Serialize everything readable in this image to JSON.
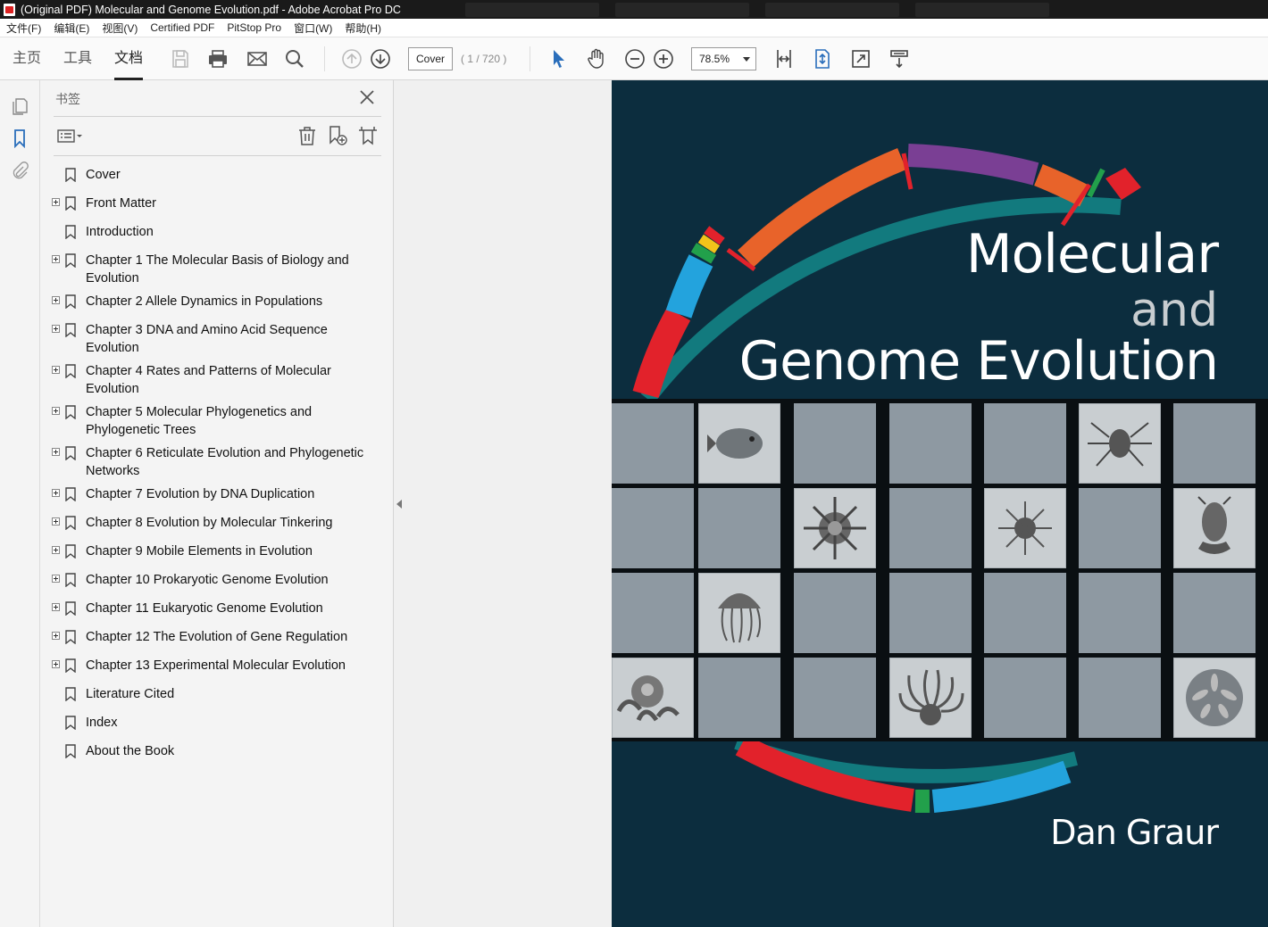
{
  "window": {
    "title": "(Original PDF) Molecular and Genome Evolution.pdf - Adobe Acrobat Pro DC"
  },
  "menubar": {
    "items": [
      "文件(F)",
      "编辑(E)",
      "视图(V)",
      "Certified PDF",
      "PitStop Pro",
      "窗口(W)",
      "帮助(H)"
    ]
  },
  "toolbar": {
    "nav": [
      "主页",
      "工具",
      "文档"
    ],
    "active_nav": "文档",
    "page_field": "Cover",
    "page_count": "( 1 / 720 )",
    "zoom": "78.5%"
  },
  "left_rail": {
    "icons": [
      "pages-icon",
      "bookmark-icon",
      "attachment-icon"
    ]
  },
  "bookmarks_panel": {
    "title": "书签",
    "items": [
      {
        "label": "Cover",
        "expandable": false
      },
      {
        "label": "Front Matter",
        "expandable": true
      },
      {
        "label": "Introduction",
        "expandable": false
      },
      {
        "label": "Chapter 1 The Molecular Basis of Biology and Evolution",
        "expandable": true
      },
      {
        "label": "Chapter 2 Allele Dynamics in Populations",
        "expandable": true
      },
      {
        "label": "Chapter 3 DNA and Amino Acid Sequence Evolution",
        "expandable": true
      },
      {
        "label": "Chapter 4 Rates and Patterns of Molecular Evolution",
        "expandable": true
      },
      {
        "label": "Chapter 5 Molecular Phylogenetics and Phylogenetic Trees",
        "expandable": true
      },
      {
        "label": "Chapter 6 Reticulate Evolution and Phylogenetic Networks",
        "expandable": true
      },
      {
        "label": "Chapter 7 Evolution by DNA Duplication",
        "expandable": true
      },
      {
        "label": "Chapter 8 Evolution by Molecular Tinkering",
        "expandable": true
      },
      {
        "label": "Chapter 9 Mobile Elements in Evolution",
        "expandable": true
      },
      {
        "label": "Chapter 10 Prokaryotic Genome Evolution",
        "expandable": true
      },
      {
        "label": "Chapter 11 Eukaryotic Genome Evolution",
        "expandable": true
      },
      {
        "label": "Chapter 12 The Evolution of Gene Regulation",
        "expandable": true
      },
      {
        "label": "Chapter 13 Experimental Molecular Evolution",
        "expandable": true
      },
      {
        "label": "Literature Cited",
        "expandable": false
      },
      {
        "label": "Index",
        "expandable": false
      },
      {
        "label": "About the Book",
        "expandable": false
      }
    ]
  },
  "cover": {
    "title_line1": "Molecular",
    "title_line2": "and",
    "title_line3": "Genome Evolution",
    "author": "Dan Graur",
    "colors": {
      "background": "#0c2d3e",
      "teal": "#127a7e",
      "orange": "#e8632a",
      "purple": "#7a3f94",
      "red": "#e2222b",
      "blue": "#23a3dd",
      "green": "#22a04b",
      "yellow": "#f2c31a"
    },
    "illustrations": [
      "pufferfish",
      "spider",
      "radiolarian",
      "sea-star-radiolarian",
      "crustacean-larva",
      "jellyfish",
      "sea-anemone",
      "octopus",
      "sand-dollar"
    ]
  }
}
